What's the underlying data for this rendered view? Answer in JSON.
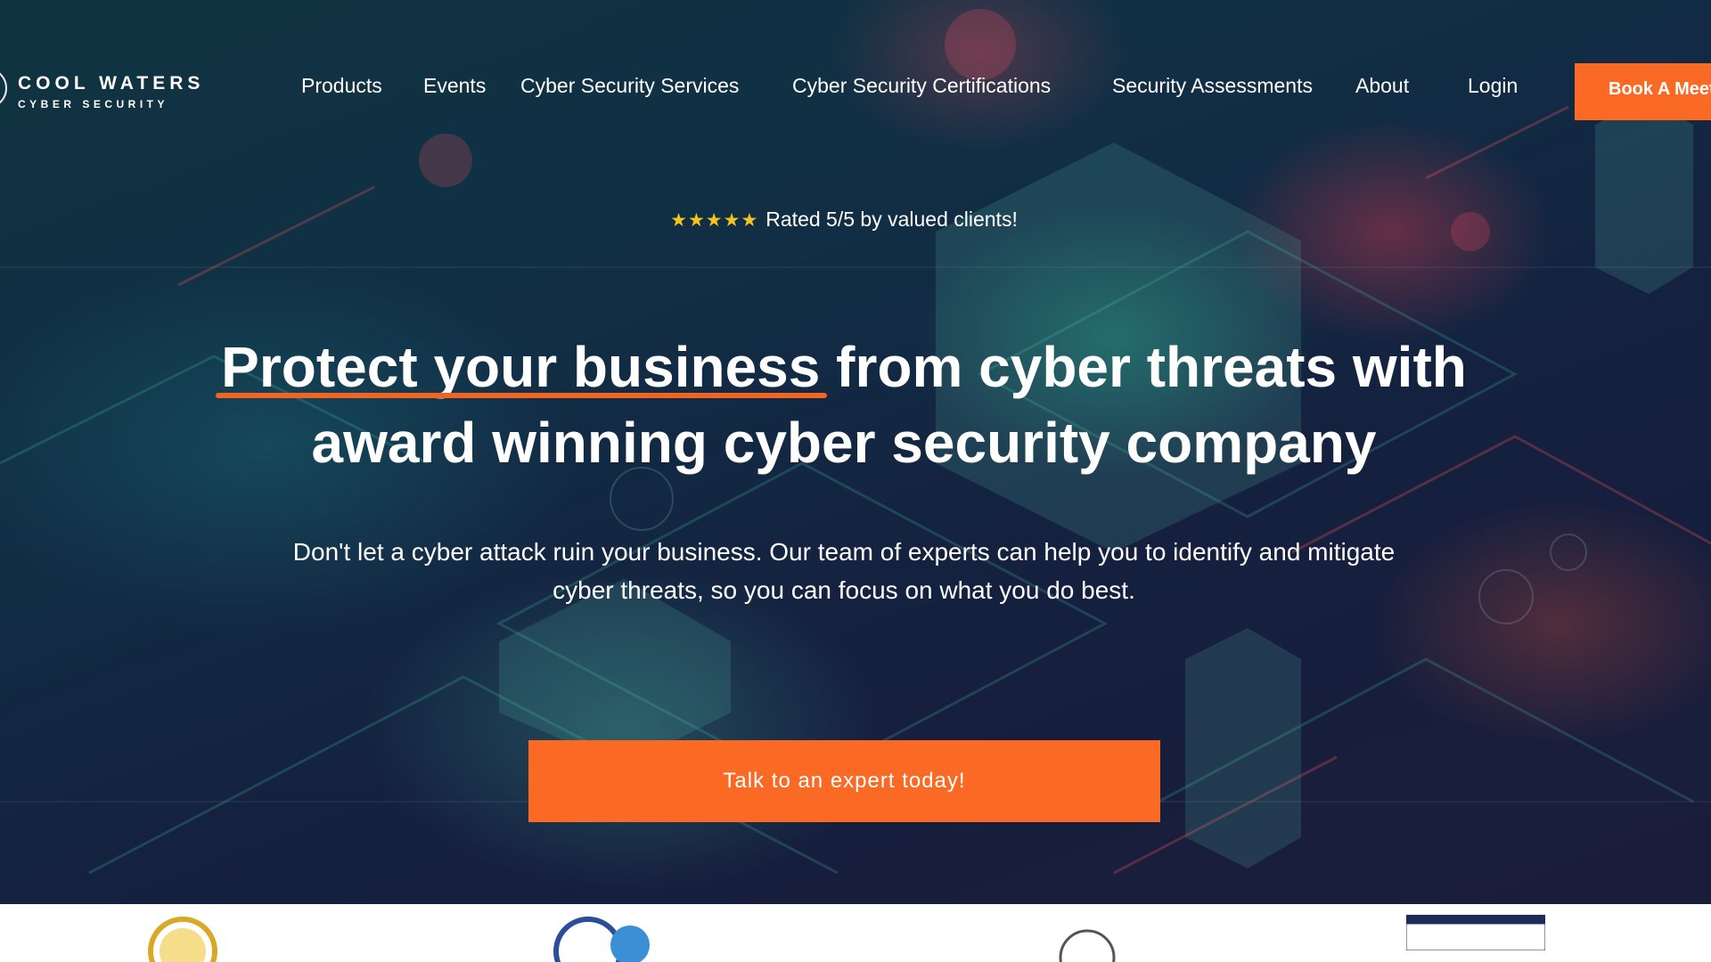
{
  "brand": {
    "name": "COOL WATERS",
    "tagline": "CYBER SECURITY"
  },
  "nav": {
    "items": [
      {
        "label": "Products"
      },
      {
        "label": "Events"
      },
      {
        "label": "Cyber Security Services"
      },
      {
        "label": "Cyber Security Certifications"
      },
      {
        "label": "Security Assessments"
      },
      {
        "label": "About"
      },
      {
        "label": "Login"
      }
    ],
    "book_button": "Book A Meeting"
  },
  "hero": {
    "stars": "★★★★★",
    "rating_text": "Rated 5/5 by valued clients!",
    "headline_highlight": "Protect your business",
    "headline_rest_line1": " from cyber threats with",
    "headline_line2": "award winning cyber security company",
    "subtext": "Don't let a cyber attack ruin your business. Our team of experts can help you to identify and mitigate cyber threats, so you can focus on what you do best.",
    "cta_label": "Talk to an expert today!"
  },
  "badges": {
    "items": [
      {
        "icon": "certification-body-badge-gold"
      },
      {
        "icon": "certification-body-badge-blue"
      },
      {
        "icon": "advisor-badge"
      },
      {
        "icon": "assured-service-provider-badge"
      }
    ]
  },
  "colors": {
    "accent": "#fb6a24",
    "star": "#f4c41e",
    "hero_dark": "#151f3e",
    "hero_teal": "#0f3440"
  }
}
